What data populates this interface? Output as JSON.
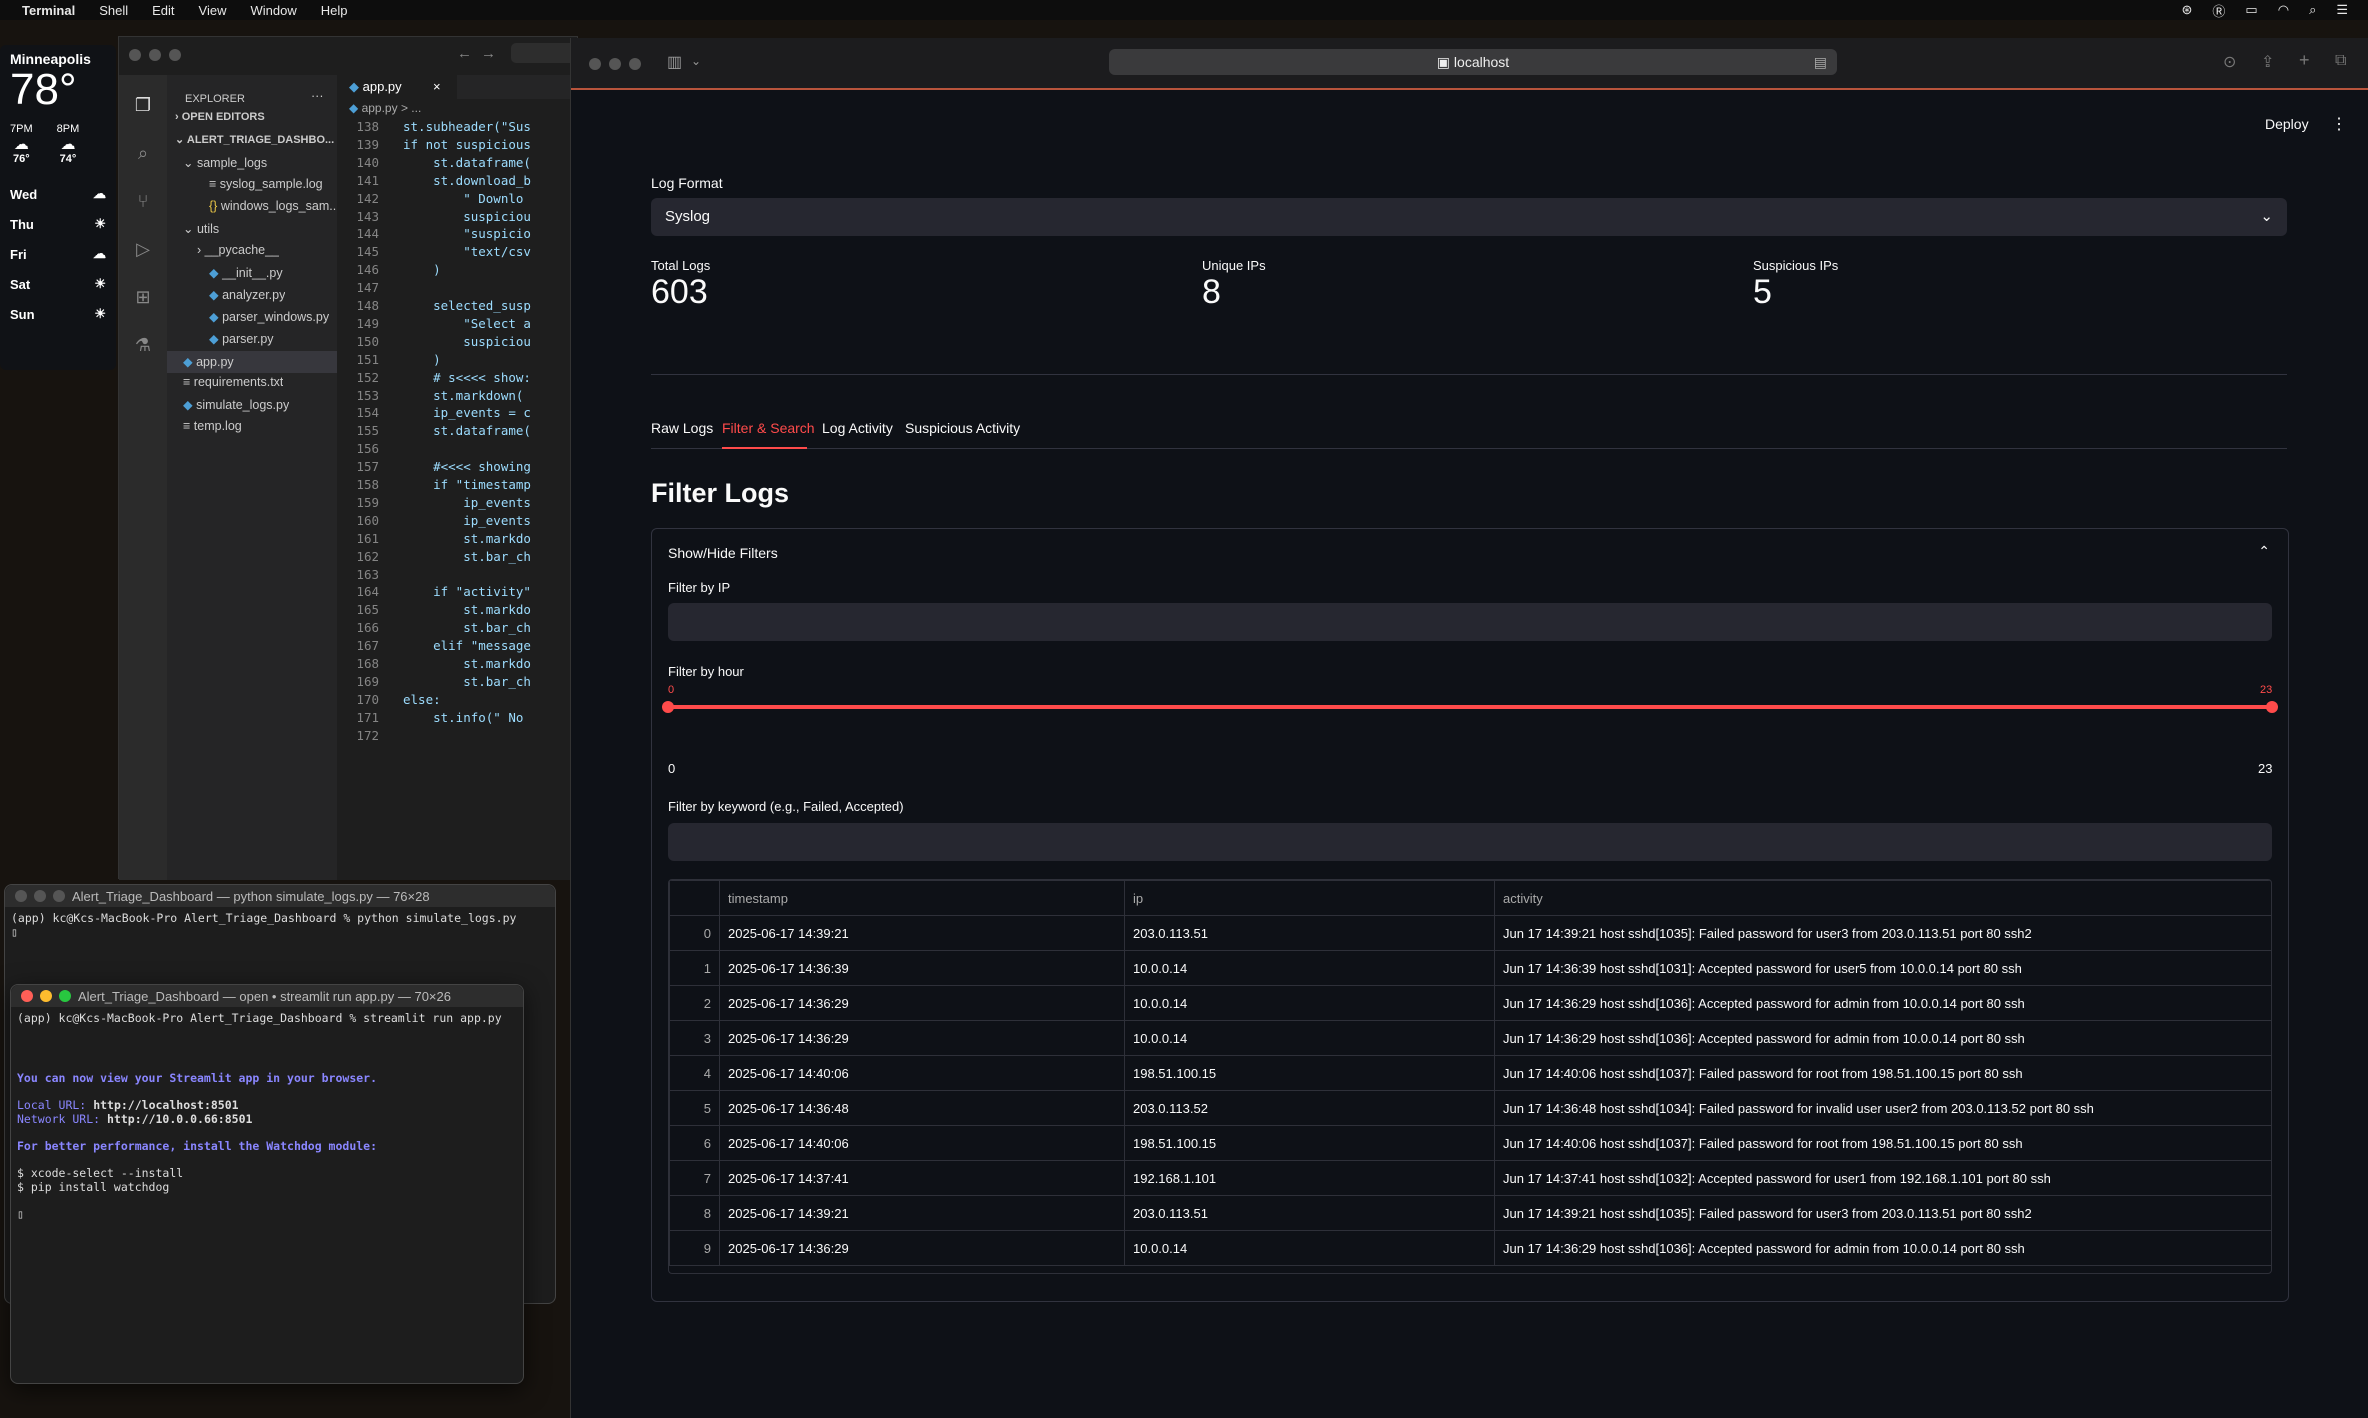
{
  "menubar": {
    "apple": "",
    "app": "Terminal",
    "items": [
      "Shell",
      "Edit",
      "View",
      "Window",
      "Help"
    ]
  },
  "weather": {
    "city": "Minneapolis",
    "temp": "78°",
    "hours": [
      {
        "time": "7PM",
        "temp": "76°"
      },
      {
        "time": "8PM",
        "temp": "74°"
      }
    ],
    "days": [
      "Wed",
      "Thu",
      "Fri",
      "Sat",
      "Sun"
    ]
  },
  "vscode": {
    "explorer_title": "EXPLORER",
    "open_editors": "OPEN EDITORS",
    "project": "ALERT_TRIAGE_DASHBO...",
    "tree": [
      "sample_logs",
      "syslog_sample.log",
      "windows_logs_sam...",
      "utils",
      "__pycache__",
      "__init__.py",
      "analyzer.py",
      "parser_windows.py",
      "parser.py",
      "app.py",
      "requirements.txt",
      "simulate_logs.py",
      "temp.log"
    ],
    "tab": "app.py",
    "breadcrumb": "app.py > ...",
    "line_numbers": [
      "138",
      "139",
      "140",
      "141",
      "142",
      "143",
      "144",
      "145",
      "146",
      "147",
      "148",
      "149",
      "150",
      "151",
      "152",
      "153",
      "154",
      "155",
      "156",
      "157",
      "158",
      "159",
      "160",
      "161",
      "162",
      "163",
      "164",
      "165",
      "166",
      "167",
      "168",
      "169",
      "170",
      "171",
      "172"
    ],
    "code": [
      "st.subheader(\"Sus",
      "if not suspicious",
      "    st.dataframe(",
      "    st.download_b",
      "        \" Downlo",
      "        suspiciou",
      "        \"suspicio",
      "        \"text/csv",
      "    )",
      "",
      "    selected_susp",
      "        \"Select a",
      "        suspiciou",
      "    )",
      "    # s<<<< show:",
      "    st.markdown(",
      "    ip_events = c",
      "    st.dataframe(",
      "",
      "    #<<<< showing",
      "    if \"timestamp",
      "        ip_events",
      "        ip_events",
      "        st.markdo",
      "        st.bar_ch",
      "",
      "    if \"activity\"",
      "        st.markdo",
      "        st.bar_ch",
      "    elif \"message",
      "        st.markdo",
      "        st.bar_ch",
      "else:",
      "    st.info(\" No",
      ""
    ]
  },
  "term1": {
    "title": "Alert_Triage_Dashboard — python simulate_logs.py — 76×28",
    "lines": [
      "(app) kc@Kcs-MacBook-Pro Alert_Triage_Dashboard % python simulate_logs.py",
      "▯"
    ]
  },
  "term2": {
    "title": "Alert_Triage_Dashboard — open • streamlit run app.py — 70×26",
    "prompt": "(app) kc@Kcs-MacBook-Pro Alert_Triage_Dashboard % streamlit run app.py",
    "line1": "You can now view your Streamlit app in your browser.",
    "local_label": "Local URL:",
    "local_url": "http://localhost:8501",
    "network_label": "Network URL:",
    "network_url": "http://10.0.0.66:8501",
    "watchdog": "For better performance, install the Watchdog module:",
    "cmd1": "$ xcode-select --install",
    "cmd2": "$ pip install watchdog",
    "cursor": "▯"
  },
  "browser": {
    "url": "localhost",
    "deploy": "Deploy",
    "log_format_label": "Log Format",
    "log_format_value": "Syslog",
    "metrics": [
      {
        "label": "Total Logs",
        "value": "603"
      },
      {
        "label": "Unique IPs",
        "value": "8"
      },
      {
        "label": "Suspicious IPs",
        "value": "5"
      }
    ],
    "tabs": [
      "Raw Logs",
      "Filter & Search",
      "Log Activity",
      "Suspicious Activity"
    ],
    "active_tab": "Filter & Search",
    "heading": "Filter Logs",
    "expander": "Show/Hide Filters",
    "filter_ip_label": "Filter by IP",
    "filter_ip_value": "",
    "filter_hour_label": "Filter by hour",
    "hour_min": "0",
    "hour_max": "23",
    "hour_low": "0",
    "hour_high": "23",
    "filter_keyword_label": "Filter by keyword (e.g., Failed, Accepted)",
    "filter_keyword_value": "",
    "table": {
      "columns": [
        "timestamp",
        "ip",
        "activity"
      ],
      "rows": [
        [
          "0",
          "2025-06-17 14:39:21",
          "203.0.113.51",
          "Jun 17 14:39:21 host sshd[1035]: Failed password for user3 from 203.0.113.51 port 80 ssh2"
        ],
        [
          "1",
          "2025-06-17 14:36:39",
          "10.0.0.14",
          "Jun 17 14:36:39 host sshd[1031]: Accepted password for user5 from 10.0.0.14 port 80 ssh"
        ],
        [
          "2",
          "2025-06-17 14:36:29",
          "10.0.0.14",
          "Jun 17 14:36:29 host sshd[1036]: Accepted password for admin from 10.0.0.14 port 80 ssh"
        ],
        [
          "3",
          "2025-06-17 14:36:29",
          "10.0.0.14",
          "Jun 17 14:36:29 host sshd[1036]: Accepted password for admin from 10.0.0.14 port 80 ssh"
        ],
        [
          "4",
          "2025-06-17 14:40:06",
          "198.51.100.15",
          "Jun 17 14:40:06 host sshd[1037]: Failed password for root from 198.51.100.15 port 80 ssh"
        ],
        [
          "5",
          "2025-06-17 14:36:48",
          "203.0.113.52",
          "Jun 17 14:36:48 host sshd[1034]: Failed password for invalid user user2 from 203.0.113.52 port 80 ssh"
        ],
        [
          "6",
          "2025-06-17 14:40:06",
          "198.51.100.15",
          "Jun 17 14:40:06 host sshd[1037]: Failed password for root from 198.51.100.15 port 80 ssh"
        ],
        [
          "7",
          "2025-06-17 14:37:41",
          "192.168.1.101",
          "Jun 17 14:37:41 host sshd[1032]: Accepted password for user1 from 192.168.1.101 port 80 ssh"
        ],
        [
          "8",
          "2025-06-17 14:39:21",
          "203.0.113.51",
          "Jun 17 14:39:21 host sshd[1035]: Failed password for user3 from 203.0.113.51 port 80 ssh2"
        ],
        [
          "9",
          "2025-06-17 14:36:29",
          "10.0.0.14",
          "Jun 17 14:36:29 host sshd[1036]: Accepted password for admin from 10.0.0.14 port 80 ssh"
        ]
      ]
    }
  },
  "colors": {
    "accent": "#ff4b4b",
    "streamlit_bg": "#0e1117",
    "input_bg": "#262730"
  }
}
